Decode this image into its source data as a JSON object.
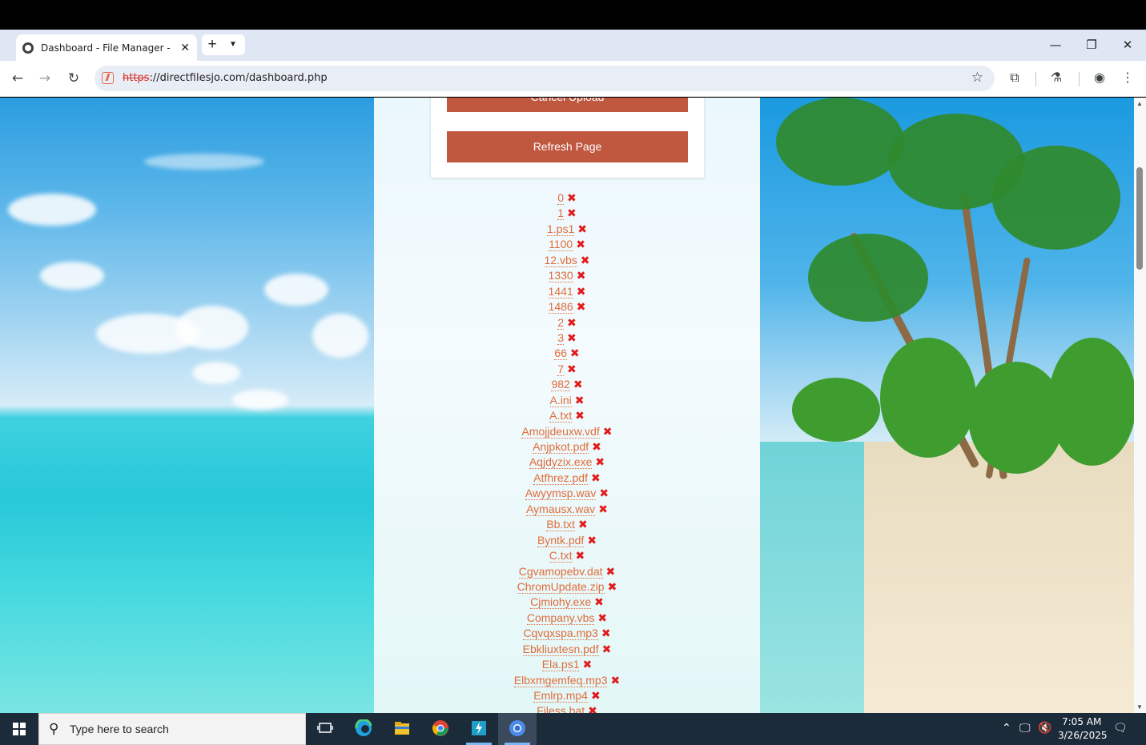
{
  "browser": {
    "tab_title": "Dashboard - File Manager - Dir",
    "tab_close": "✕",
    "new_tab": "+",
    "tab_search": "▼",
    "minimize": "—",
    "restore": "❐",
    "close": "✕",
    "url_scheme": "https",
    "url_rest": "://directfilesjo.com/dashboard.php"
  },
  "page": {
    "cancel_label": "Cancel Upload",
    "refresh_label": "Refresh Page",
    "delete_glyph": "✖",
    "files": [
      "0",
      "1",
      "1.ps1",
      "1100",
      "12.vbs",
      "1330",
      "1441",
      "1486",
      "2",
      "3",
      "66",
      "7",
      "982",
      "A.ini",
      "A.txt",
      "Amojjdeuxw.vdf",
      "Anjpkot.pdf",
      "Aqjdyzix.exe",
      "Atfhrez.pdf",
      "Awyymsp.wav",
      "Aymausx.wav",
      "Bb.txt",
      "Byntk.pdf",
      "C.txt",
      "Cgvamopebv.dat",
      "ChromUpdate.zip",
      "Cjmiohy.exe",
      "Company.vbs",
      "Cqvqxspa.mp3",
      "Ebkliuxtesn.pdf",
      "Ela.ps1",
      "Elbxmgemfeq.mp3",
      "Emlrp.mp4",
      "Filess.bat"
    ]
  },
  "taskbar": {
    "search_placeholder": "Type here to search",
    "time": "7:05 AM",
    "date": "3/26/2025"
  },
  "colors": {
    "button": "#c0573f",
    "link": "#e06c3a",
    "delete": "#e21b1b"
  }
}
